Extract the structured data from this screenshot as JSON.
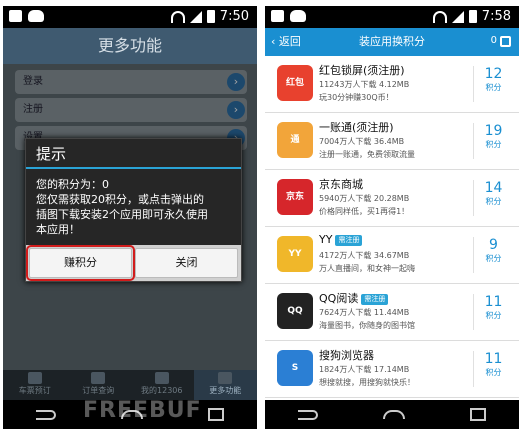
{
  "left": {
    "time": "7:50",
    "title": "更多功能",
    "menu": [
      "登录",
      "注册",
      "设置"
    ],
    "dialog": {
      "title": "提示",
      "lines": [
        "您的积分为：0",
        "您仅需获取20积分，或点击弹出的",
        "插图下载安装2个应用即可永久使用",
        "本应用！"
      ],
      "btn_primary": "赚积分",
      "btn_secondary": "关闭",
      "highlight_color": "#d21c1c"
    },
    "tabs": [
      {
        "label": "车票预订",
        "icon": "train-icon"
      },
      {
        "label": "订单查询",
        "icon": "clipboard-icon"
      },
      {
        "label": "我的12306",
        "icon": "people-icon"
      },
      {
        "label": "更多功能",
        "icon": "more-icon"
      }
    ],
    "watermark": "FREEBUF"
  },
  "right": {
    "time": "7:58",
    "back_label": "返回",
    "title": "装应用换积分",
    "header_count": "0",
    "apps": [
      {
        "name": "红包锁屏(须注册)",
        "icon_text": "红包",
        "icon_color": "#e8412e",
        "stats": "11243万人下载   4.12MB",
        "desc": "玩30分钟赚30Q币！",
        "points": "12",
        "badge": ""
      },
      {
        "name": "一账通(须注册)",
        "icon_text": "通",
        "icon_color": "#f2a53a",
        "stats": "7004万人下载   36.4MB",
        "desc": "注册一账通，免费领取流量",
        "points": "19",
        "badge": ""
      },
      {
        "name": "京东商城",
        "icon_text": "京东",
        "icon_color": "#d6262b",
        "stats": "5940万人下载   20.28MB",
        "desc": "价格同样低，买1再得1！",
        "points": "14",
        "badge": ""
      },
      {
        "name": "YY",
        "icon_text": "YY",
        "icon_color": "#f0b72a",
        "stats": "4172万人下载   34.67MB",
        "desc": "万人直播间，和女神一起嗨",
        "points": "9",
        "badge": "需注册"
      },
      {
        "name": "QQ阅读",
        "icon_text": "QQ",
        "icon_color": "#222222",
        "stats": "7624万人下载   11.44MB",
        "desc": "海量图书，你随身的图书馆",
        "points": "11",
        "badge": "需注册"
      },
      {
        "name": "搜狗浏览器",
        "icon_text": "S",
        "icon_color": "#2b7fd4",
        "stats": "1824万人下载   17.14MB",
        "desc": "想搜就搜，用搜狗就快乐！",
        "points": "11",
        "badge": ""
      }
    ],
    "points_unit": "积分"
  }
}
